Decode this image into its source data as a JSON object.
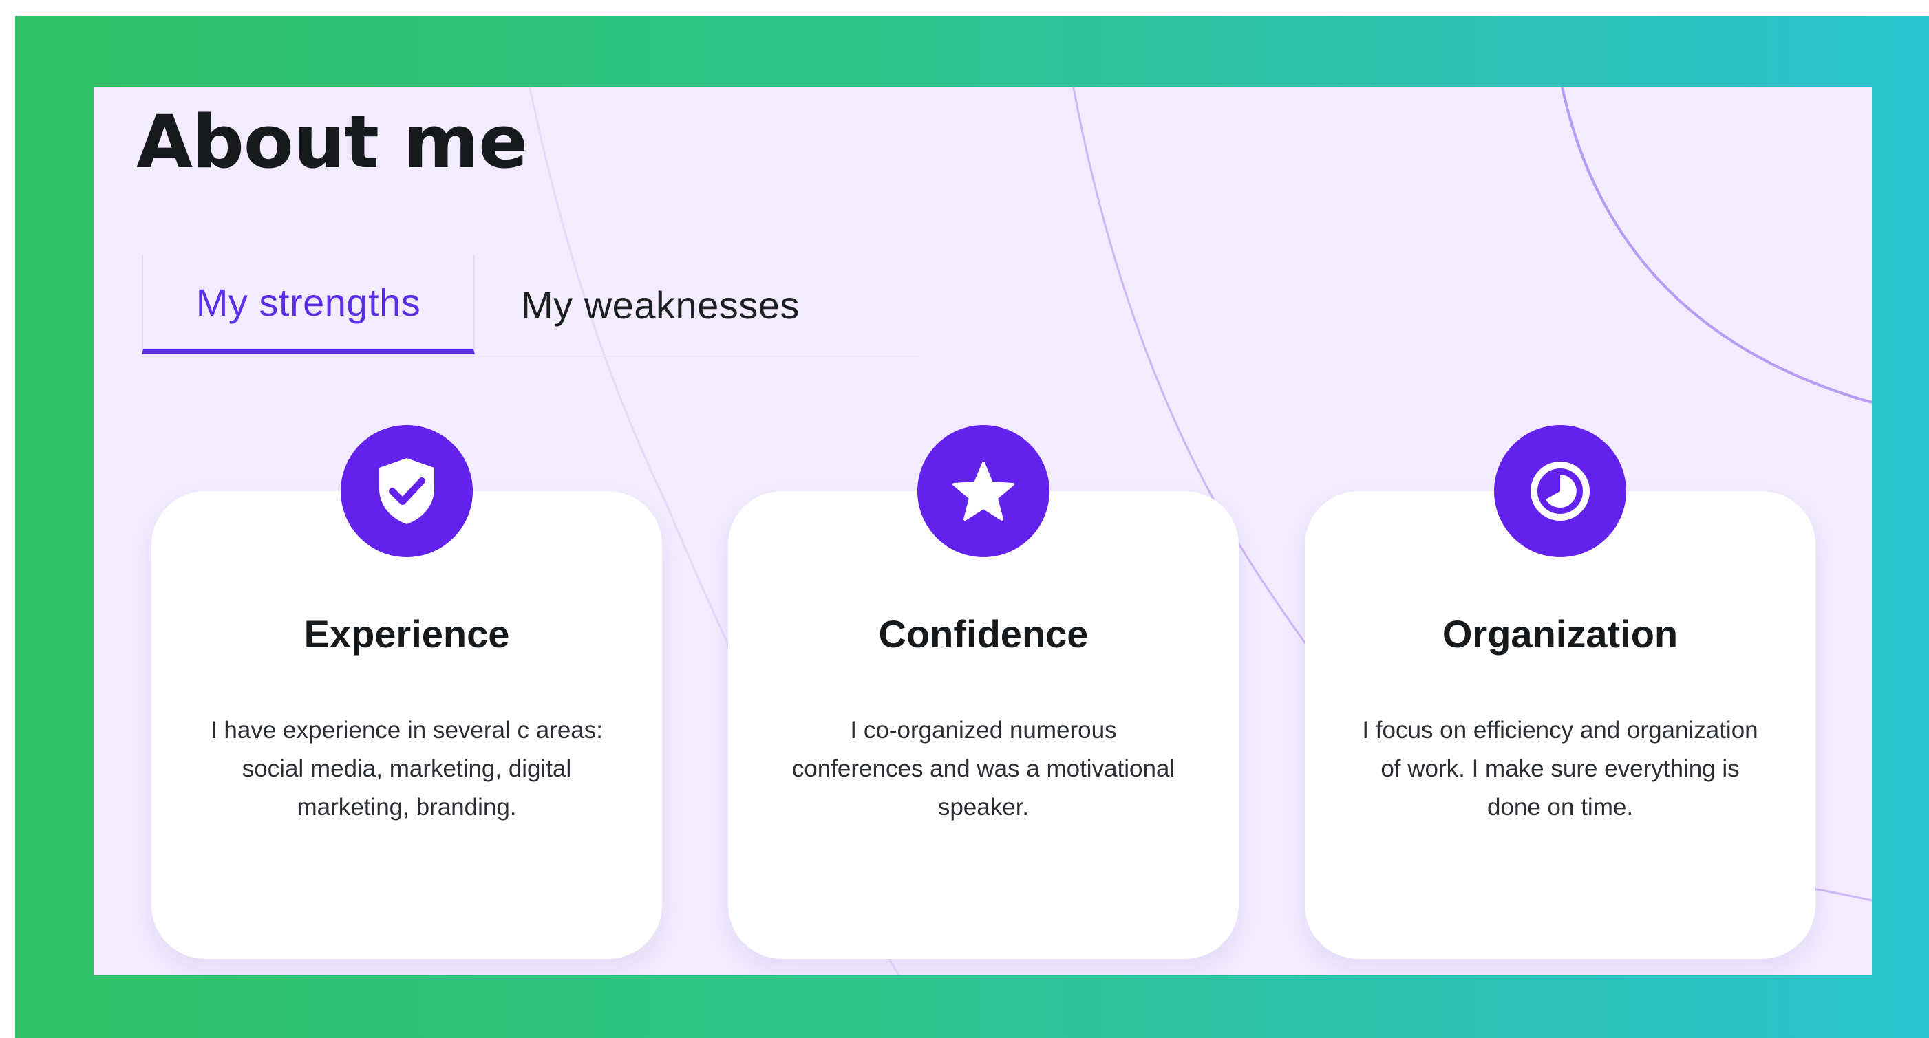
{
  "page": {
    "title": "About me"
  },
  "tabs": [
    {
      "label": "My strengths",
      "active": true
    },
    {
      "label": "My weaknesses",
      "active": false
    }
  ],
  "cards": [
    {
      "icon": "shield-check-icon",
      "title": "Experience",
      "text": "I have experience in several c areas: social media, marketing, digital marketing, branding."
    },
    {
      "icon": "star-icon",
      "title": "Confidence",
      "text": "I co-organized numerous conferences and was a motivational speaker."
    },
    {
      "icon": "clock-icon",
      "title": "Organization",
      "text": "I focus on efficiency and organization of work. I make sure everything is done on time."
    }
  ],
  "colors": {
    "accent": "#6321ec",
    "tab_active": "#5b2fe3",
    "panel_background": "#f3ecff",
    "frame_gradient_start": "#31c267",
    "frame_gradient_end": "#2bc3cf",
    "text_dark": "#161a1d"
  }
}
